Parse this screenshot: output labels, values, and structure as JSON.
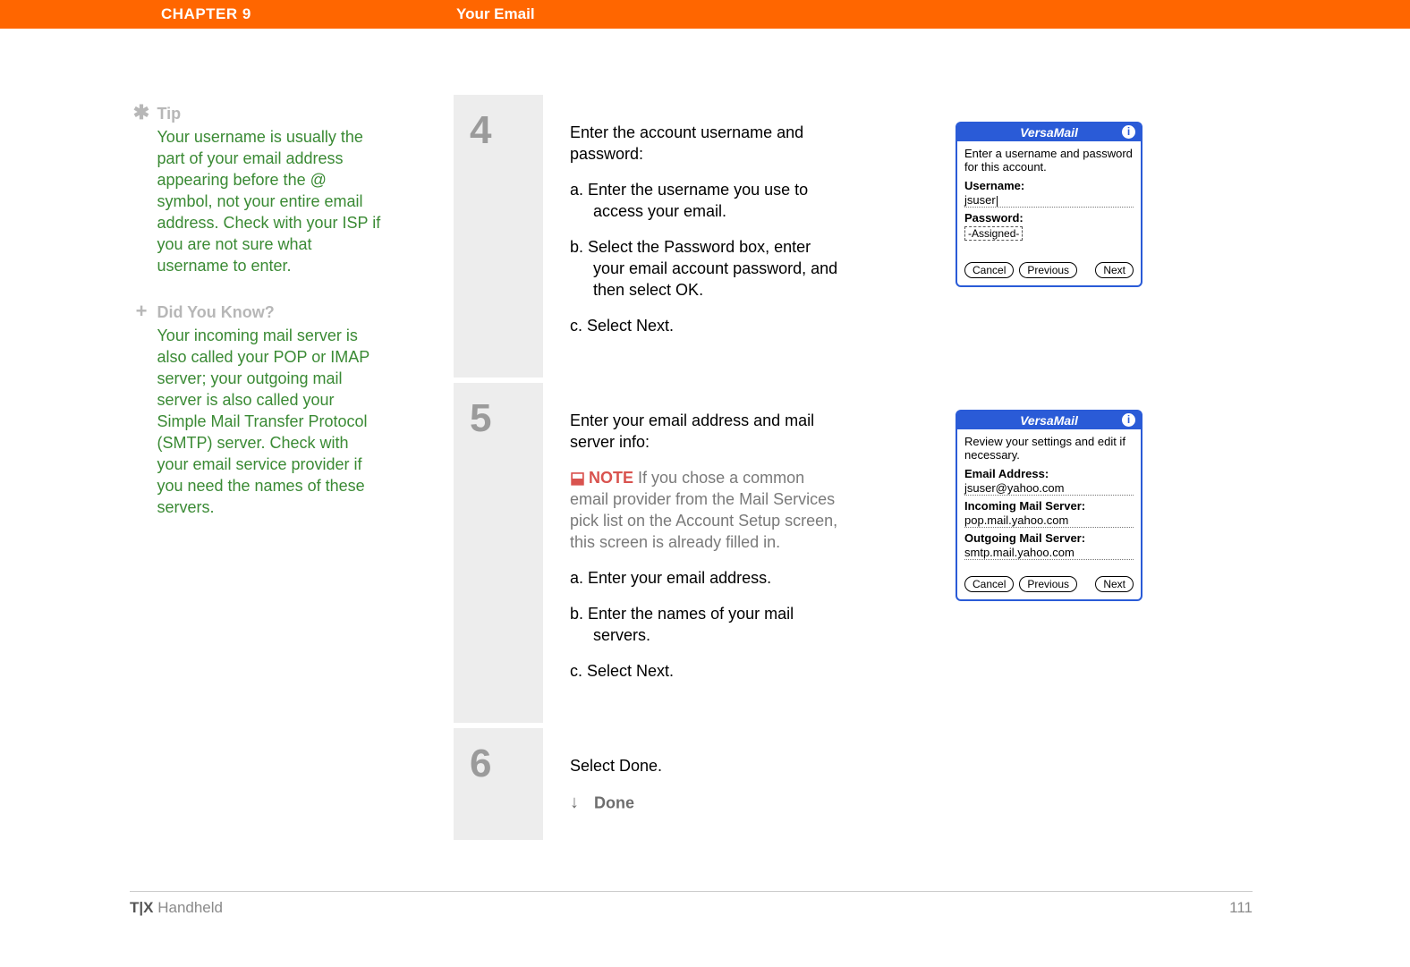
{
  "header": {
    "chapter": "CHAPTER 9",
    "title": "Your Email"
  },
  "sidebar": {
    "tip": {
      "icon": "✱",
      "heading": "Tip",
      "body": "Your username is usually the part of your email address appearing before the @ symbol, not your entire email address. Check with your ISP if you are not sure what username to enter."
    },
    "dyk": {
      "icon": "+",
      "heading": "Did You Know?",
      "body": "Your incoming mail server is also called your POP or IMAP server; your outgoing mail server is also called your Simple Mail Transfer Protocol (SMTP) server. Check with your email service provider if you need the names of these servers."
    }
  },
  "steps": {
    "s4": {
      "num": "4",
      "lead": "Enter the account username and password:",
      "a": "a.  Enter the username you use to access your email.",
      "b": "b.  Select the Password box, enter your email account password, and then select OK.",
      "c": "c.  Select Next.",
      "device": {
        "title": "VersaMail",
        "text": "Enter a username and password for this account.",
        "usernameLabel": "Username:",
        "usernameValue": "jsuser",
        "passwordLabel": "Password:",
        "passwordValue": "-Assigned-",
        "cancel": "Cancel",
        "previous": "Previous",
        "next": "Next"
      }
    },
    "s5": {
      "num": "5",
      "lead": "Enter your email address and mail server info:",
      "noteLabel": "NOTE",
      "noteText": " If you chose a common email provider from the Mail Services pick list on the Account Setup screen, this screen is already filled in.",
      "a": "a.  Enter your email address.",
      "b": "b.  Enter the names of your mail servers.",
      "c": "c.  Select Next.",
      "device": {
        "title": "VersaMail",
        "text": "Review your settings and edit if necessary.",
        "emailLabel": "Email Address:",
        "emailValue": "jsuser@yahoo.com",
        "inLabel": "Incoming Mail Server:",
        "inValue": "pop.mail.yahoo.com",
        "outLabel": "Outgoing Mail Server:",
        "outValue": "smtp.mail.yahoo.com",
        "cancel": "Cancel",
        "previous": "Previous",
        "next": "Next"
      }
    },
    "s6": {
      "num": "6",
      "lead": "Select Done.",
      "doneIcon": "↓",
      "doneWord": "Done"
    }
  },
  "footer": {
    "product1": "T|X",
    "product2": " Handheld",
    "page": "111"
  }
}
